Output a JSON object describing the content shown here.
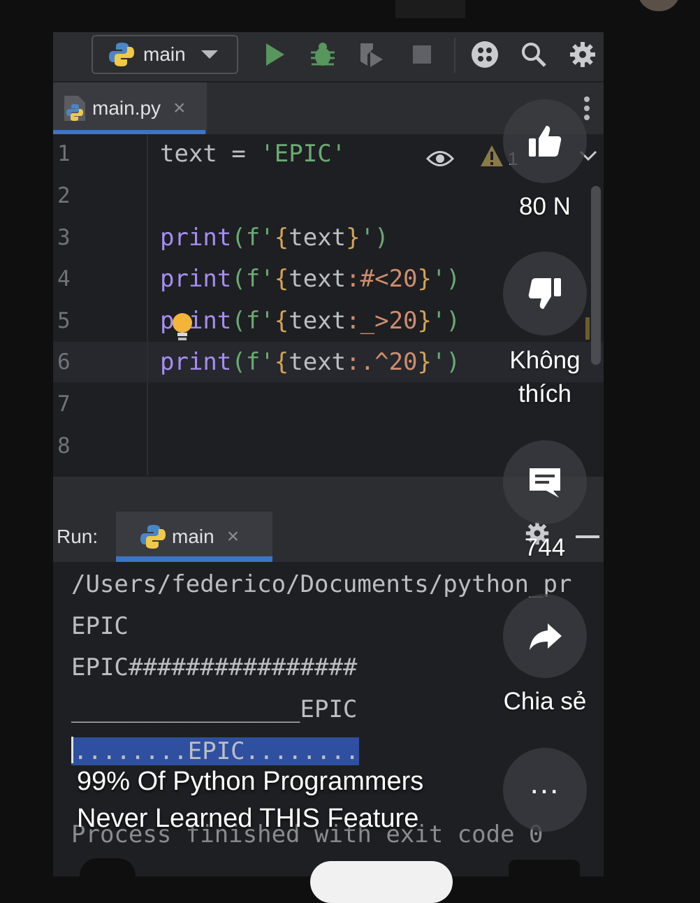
{
  "toolbar": {
    "run_config": "main"
  },
  "editor_tab": {
    "filename": "main.py",
    "close": "×"
  },
  "editor": {
    "line_numbers": [
      "1",
      "2",
      "3",
      "4",
      "5",
      "6",
      "7",
      "8"
    ],
    "inspection_count": "1",
    "line1": {
      "var": "text",
      "op": " = ",
      "str": "'EPIC'"
    },
    "lines": [
      {
        "kw": "print",
        "p1": "(f'",
        "b1": "{",
        "v": "text",
        "fmt": "",
        "b2": "}",
        "p2": "')"
      },
      {
        "kw": "print",
        "p1": "(f'",
        "b1": "{",
        "v": "text",
        "fmt": ":#<20",
        "b2": "}",
        "p2": "')"
      },
      {
        "kw": "print",
        "p1": "(f'",
        "b1": "{",
        "v": "text",
        "fmt": ":_>20",
        "b2": "}",
        "p2": "')"
      },
      {
        "kw": "print",
        "p1": "(f'",
        "b1": "{",
        "v": "text",
        "fmt": ":.^20",
        "b2": "}",
        "p2": "')"
      }
    ]
  },
  "run_panel": {
    "label": "Run:",
    "tab": "main",
    "close": "×"
  },
  "console": {
    "path": "/Users/federico/Documents/python_pr",
    "out1": "EPIC",
    "out2": "EPIC################",
    "out3": "________________EPIC",
    "out4": "........EPIC........",
    "exit": "Process finished with exit code 0"
  },
  "overlay": {
    "like_count": "80 N",
    "dislike_label": "Không thích",
    "comment_count": "744",
    "share_label": "Chia sẻ",
    "more_label": "...",
    "caption_line1": "99% Of Python Programmers",
    "caption_line2": "Never Learned THIS Feature"
  },
  "colors": {
    "keyword": "#a68df2",
    "string": "#6aab73",
    "brace": "#d5a354",
    "selection": "#2f4fa0",
    "accent": "#3d74c6"
  }
}
